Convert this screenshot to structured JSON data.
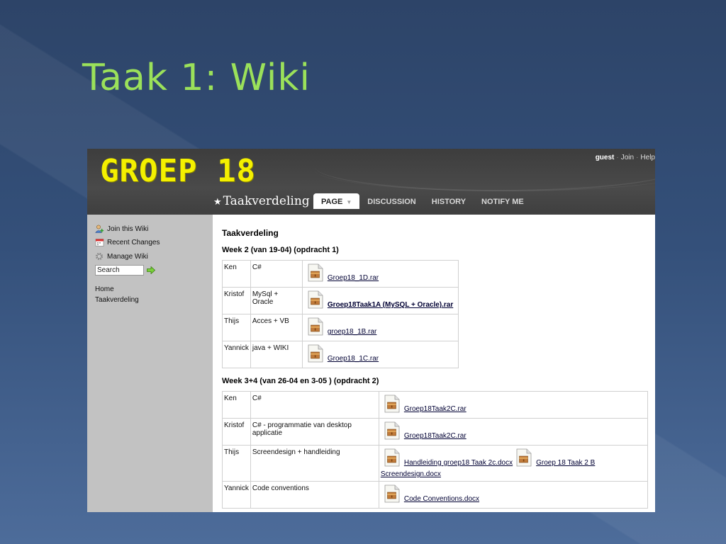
{
  "slide": {
    "title": "Taak 1: Wiki"
  },
  "wiki": {
    "logo": "GROEP 18",
    "user": {
      "guest": "guest",
      "join": "Join",
      "help": "Help"
    },
    "page_name": "Taakverdeling",
    "tabs": [
      {
        "label": "PAGE",
        "active": true
      },
      {
        "label": "DISCUSSION",
        "active": false
      },
      {
        "label": "HISTORY",
        "active": false
      },
      {
        "label": "NOTIFY ME",
        "active": false
      }
    ],
    "sidebar": {
      "items": [
        {
          "label": "Join this Wiki",
          "icon": "user-add-icon"
        },
        {
          "label": "Recent Changes",
          "icon": "calendar-icon"
        },
        {
          "label": "Manage Wiki",
          "icon": "gear-icon"
        }
      ],
      "search_value": "Search",
      "links": [
        "Home",
        "Taakverdeling"
      ]
    },
    "content": {
      "heading": "Taakverdeling",
      "week2_title": "Week 2 (van 19-04) (opdracht 1)",
      "week2_rows": [
        {
          "name": "Ken",
          "task": "C#",
          "file": "Groep18_1D.rar"
        },
        {
          "name": "Kristof",
          "task": "MySql + Oracle",
          "file": "Groep18Taak1A (MySQL + Oracle).rar"
        },
        {
          "name": "Thijs",
          "task": "Acces + VB",
          "file": "groep18_1B.rar"
        },
        {
          "name": "Yannick",
          "task": "java + WIKI",
          "file": "Groep18_1C.rar"
        }
      ],
      "week34_title": "Week 3+4 (van 26-04 en 3-05 ) (opdracht 2)",
      "week34_rows": [
        {
          "name": "Ken",
          "task": "C#",
          "file": "Groep18Taak2C.rar"
        },
        {
          "name": "Kristof",
          "task": "C# - programmatie van desktop applicatie",
          "file": "Groep18Taak2C.rar"
        },
        {
          "name": "Thijs",
          "task": "Screendesign + handleiding",
          "file": "Handleiding groep18 Taak 2c.docx",
          "file2": "Groep 18 Taak 2 B",
          "file2_cont": "Screendesign.docx"
        },
        {
          "name": "Yannick",
          "task": "Code conventions",
          "file": "Code Conventions.docx"
        }
      ]
    }
  },
  "colors": {
    "title_green": "#9be15a",
    "logo_yellow": "#f4f000",
    "header_gray": "#444444",
    "sidebar_gray": "#c2c2c2"
  }
}
